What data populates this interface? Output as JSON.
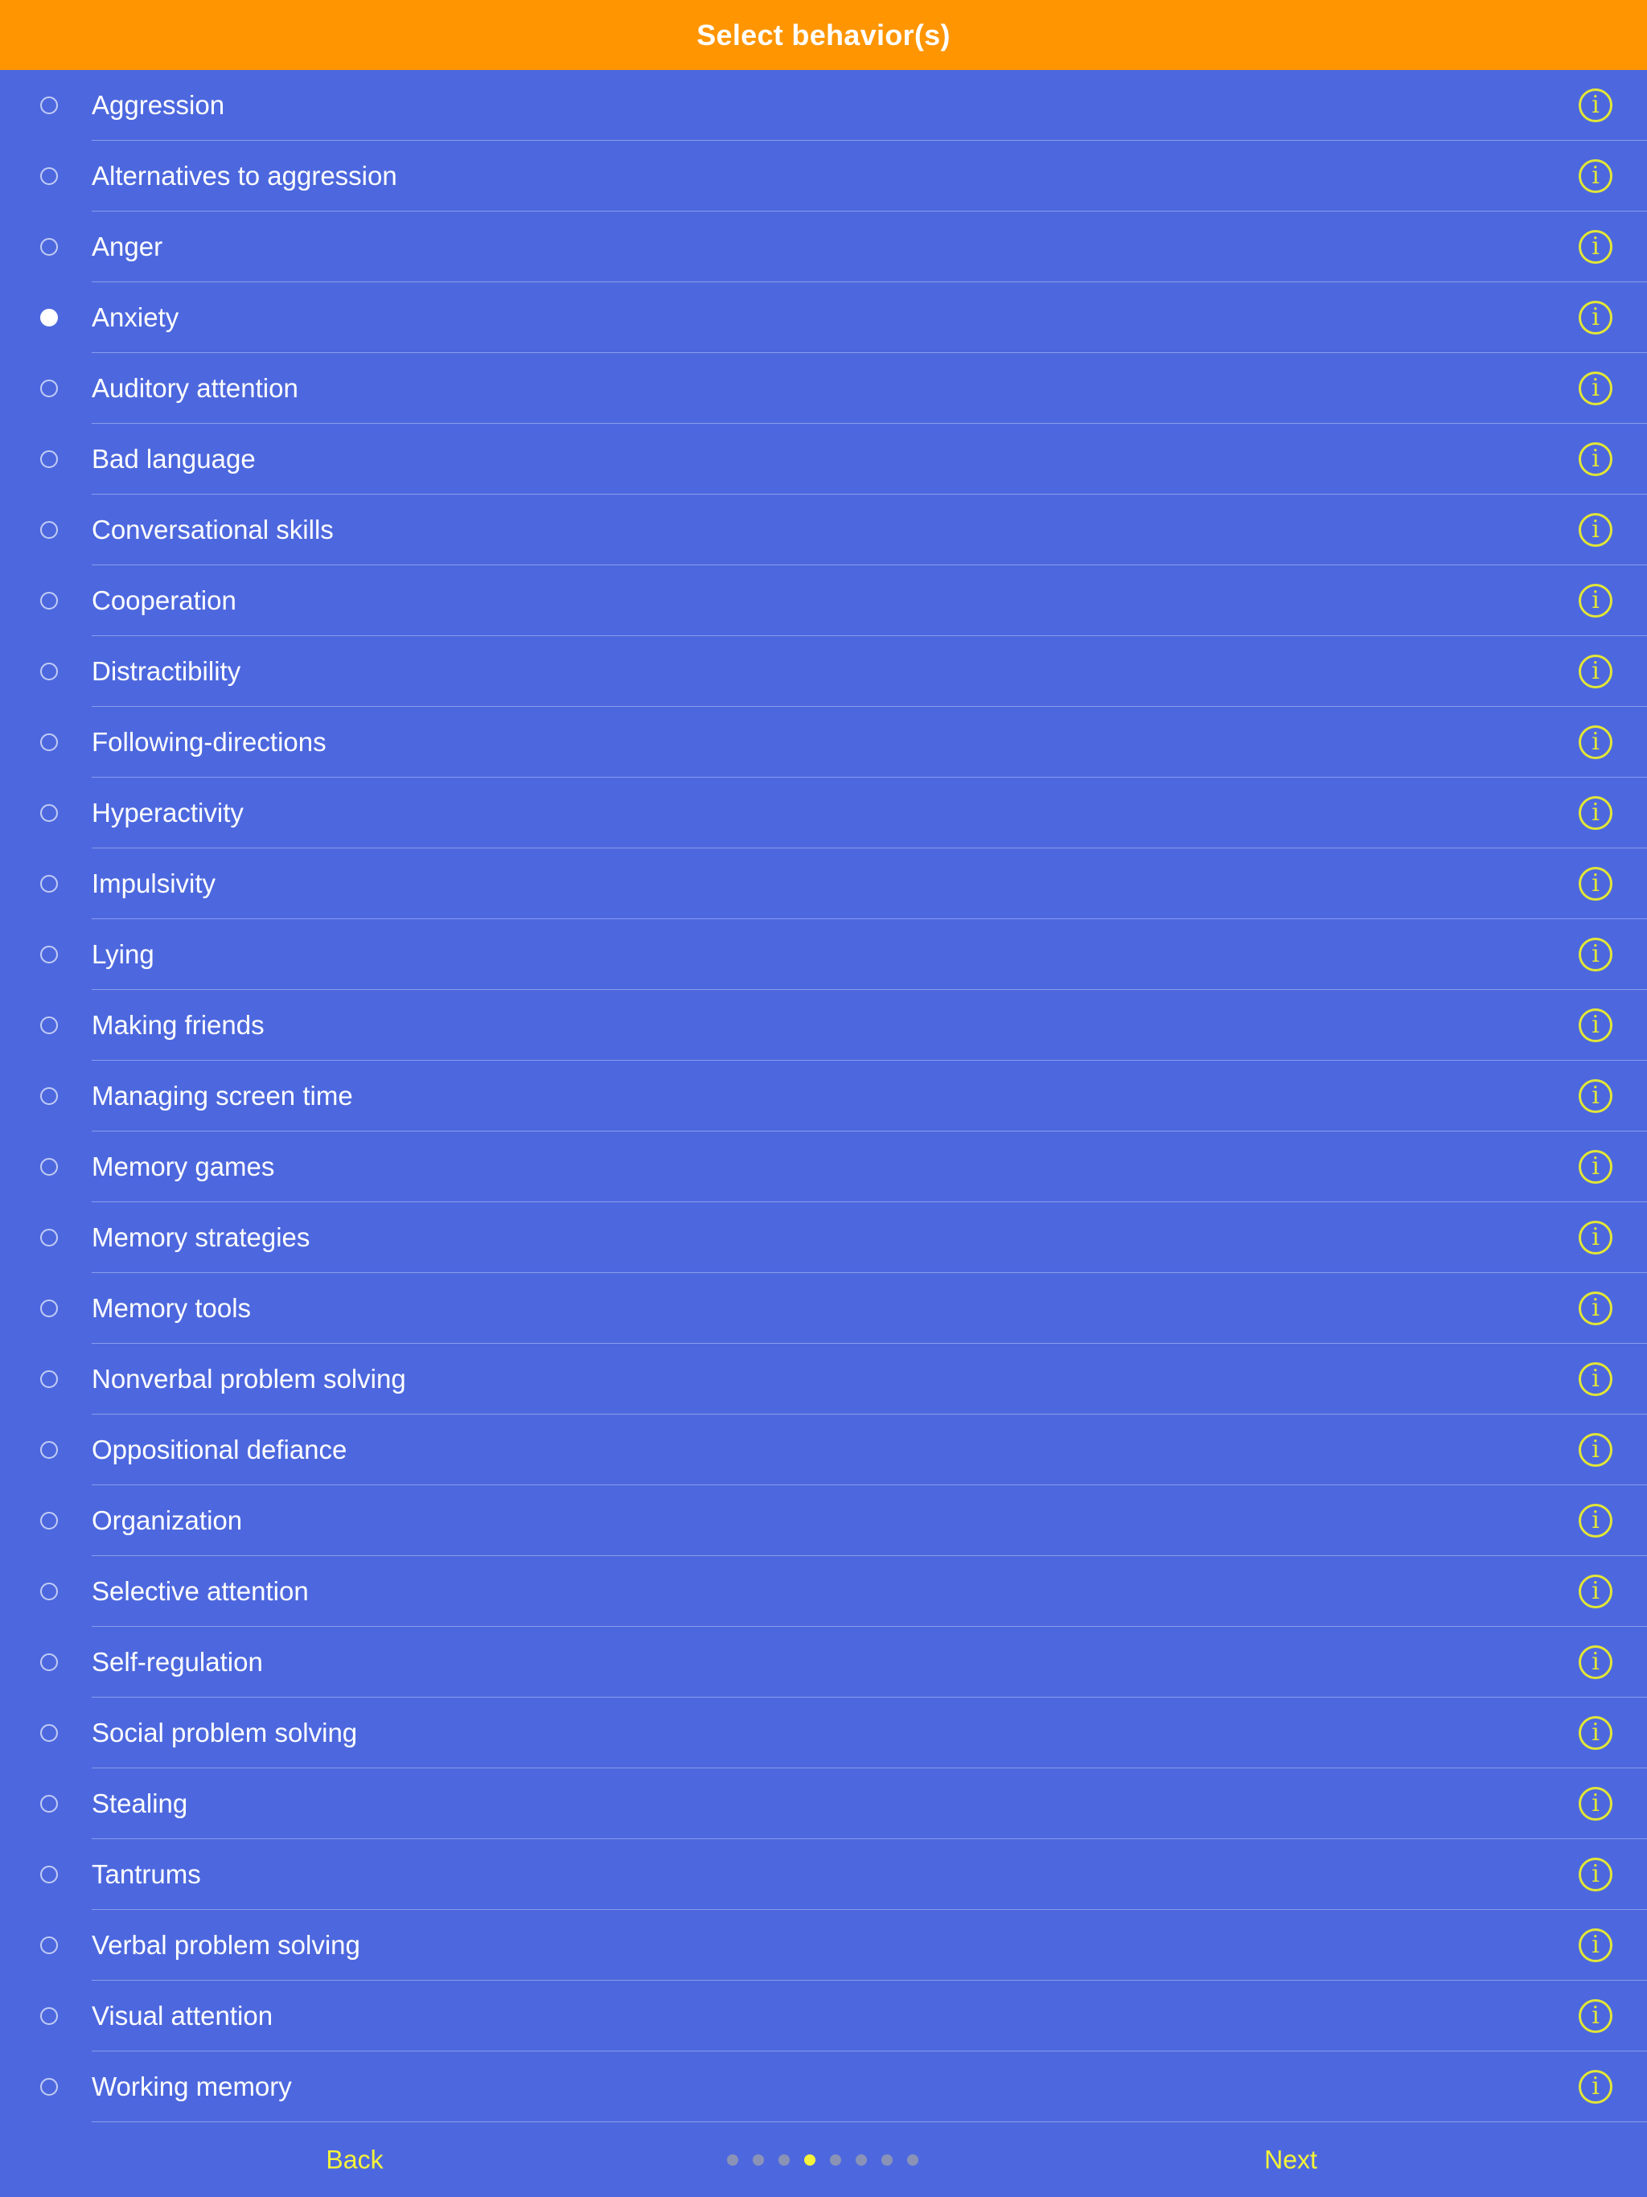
{
  "header": {
    "title": "Select behavior(s)"
  },
  "behaviors": [
    {
      "label": "Aggression",
      "selected": false
    },
    {
      "label": "Alternatives to aggression",
      "selected": false
    },
    {
      "label": "Anger",
      "selected": false
    },
    {
      "label": "Anxiety",
      "selected": true
    },
    {
      "label": "Auditory attention",
      "selected": false
    },
    {
      "label": "Bad language",
      "selected": false
    },
    {
      "label": "Conversational skills",
      "selected": false
    },
    {
      "label": "Cooperation",
      "selected": false
    },
    {
      "label": "Distractibility",
      "selected": false
    },
    {
      "label": "Following-directions",
      "selected": false
    },
    {
      "label": "Hyperactivity",
      "selected": false
    },
    {
      "label": "Impulsivity",
      "selected": false
    },
    {
      "label": "Lying",
      "selected": false
    },
    {
      "label": "Making friends",
      "selected": false
    },
    {
      "label": "Managing screen time",
      "selected": false
    },
    {
      "label": "Memory games",
      "selected": false
    },
    {
      "label": "Memory strategies",
      "selected": false
    },
    {
      "label": "Memory tools",
      "selected": false
    },
    {
      "label": "Nonverbal problem solving",
      "selected": false
    },
    {
      "label": "Oppositional defiance",
      "selected": false
    },
    {
      "label": "Organization",
      "selected": false
    },
    {
      "label": "Selective attention",
      "selected": false
    },
    {
      "label": "Self-regulation",
      "selected": false
    },
    {
      "label": "Social problem solving",
      "selected": false
    },
    {
      "label": "Stealing",
      "selected": false
    },
    {
      "label": "Tantrums",
      "selected": false
    },
    {
      "label": "Verbal problem solving",
      "selected": false
    },
    {
      "label": "Visual attention",
      "selected": false
    },
    {
      "label": "Working memory",
      "selected": false
    }
  ],
  "info_glyph": "i",
  "info_icon": "info-circle-icon",
  "footer": {
    "back_label": "Back",
    "next_label": "Next",
    "page_count": 8,
    "current_page": 4
  },
  "colors": {
    "header_bg": "#ff9500",
    "body_bg": "#4d68de",
    "accent": "#f5f33a",
    "info_icon": "#e2e636",
    "text": "#ffffff"
  }
}
